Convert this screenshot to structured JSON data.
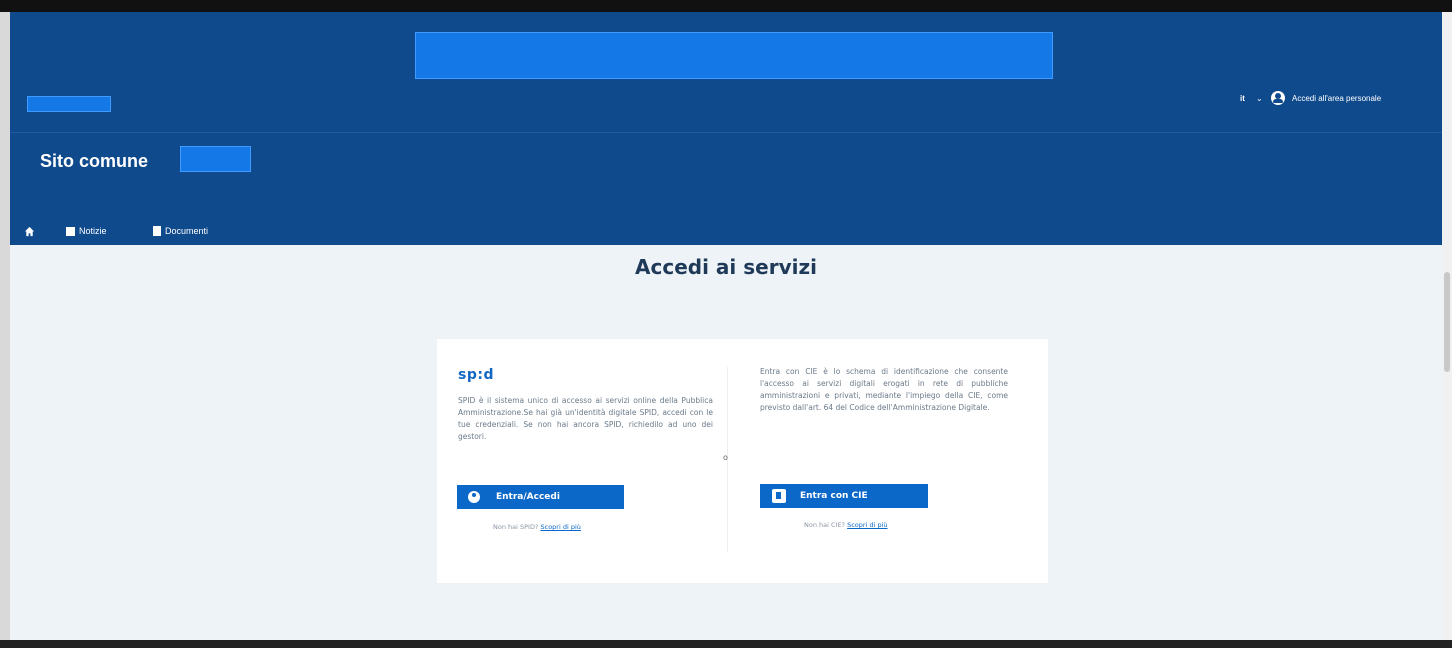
{
  "header": {
    "language": "it",
    "personal_area": "Accedi all'area personale",
    "site_title": "Sito comune"
  },
  "nav": {
    "items": [
      {
        "label": ""
      },
      {
        "label": "Notizie"
      },
      {
        "label": "Documenti"
      }
    ]
  },
  "main": {
    "title": "Accedi ai servizi",
    "spid": {
      "logo": "sp:d",
      "text": "SPID è il sistema unico di accesso ai servizi online della Pubblica Amministrazione.Se hai già un'identità digitale SPID, accedi con le tue credenziali. Se non hai ancora SPID, richiedilo ad uno dei gestori.",
      "button": "Entra/Accedi",
      "help_prefix": "Non hai SPID?",
      "help_link": "Scopri di più"
    },
    "separator": "o",
    "cie": {
      "text": "Entra con CIE è lo schema di identificazione che consente l'accesso ai servizi digitali erogati in rete di pubbliche amministrazioni e privati, mediante l'impiego della CIE, come previsto dall'art. 64 del Codice dell'Amministrazione Digitale.",
      "button": "Entra con CIE",
      "help_prefix": "Non hai CIE?",
      "help_link": "Scopri di più"
    }
  },
  "icons": {
    "home": "home-icon",
    "news": "newspaper-icon",
    "document": "document-icon",
    "user": "user-icon",
    "chevron": "chevron-down-icon",
    "cie": "cie-card-icon"
  },
  "colors": {
    "header_bg": "#0f4a8d",
    "main_bg": "#edf3f7",
    "button_blue": "#0b67c8",
    "redaction_blue": "#1478e6"
  }
}
